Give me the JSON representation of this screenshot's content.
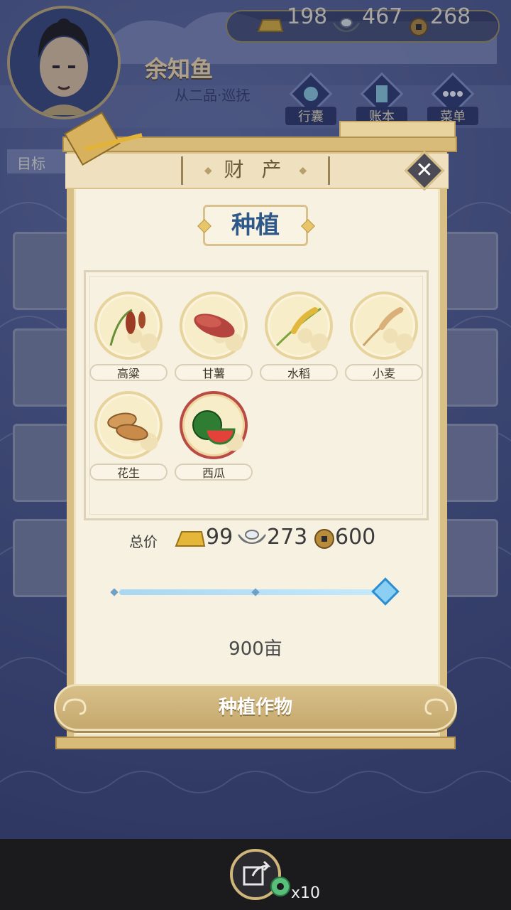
{
  "player": {
    "name": "余知鱼",
    "rank": "从二品·巡抚"
  },
  "resources": {
    "gold": "198",
    "silver": "467",
    "coins": "268"
  },
  "top_menu": [
    {
      "label": "行囊",
      "icon": "bag-icon"
    },
    {
      "label": "账本",
      "icon": "ledger-icon"
    },
    {
      "label": "菜单",
      "icon": "more-icon"
    }
  ],
  "goal": {
    "label": "目标"
  },
  "dialog": {
    "title": "财 产",
    "section_title": "种植",
    "crops": [
      {
        "label": "高粱",
        "icon": "sorghum-icon",
        "selected": false
      },
      {
        "label": "甘薯",
        "icon": "sweet-potato-icon",
        "selected": false
      },
      {
        "label": "水稻",
        "icon": "rice-icon",
        "selected": false
      },
      {
        "label": "小麦",
        "icon": "wheat-icon",
        "selected": false
      },
      {
        "label": "花生",
        "icon": "peanut-icon",
        "selected": false
      },
      {
        "label": "西瓜",
        "icon": "watermelon-icon",
        "selected": true
      }
    ],
    "total_label": "总价",
    "total_gold": "99",
    "total_silver": "273",
    "total_coins": "600",
    "slider_fraction": 1.0,
    "acres_text": "900亩",
    "plant_button": "种植作物"
  },
  "bottom": {
    "share_count": "x10"
  },
  "colors": {
    "accent_gold": "#d7bf85",
    "title_blue": "#2e5889",
    "slider_blue": "#2c8fd2",
    "selected_red": "#b94b47"
  }
}
